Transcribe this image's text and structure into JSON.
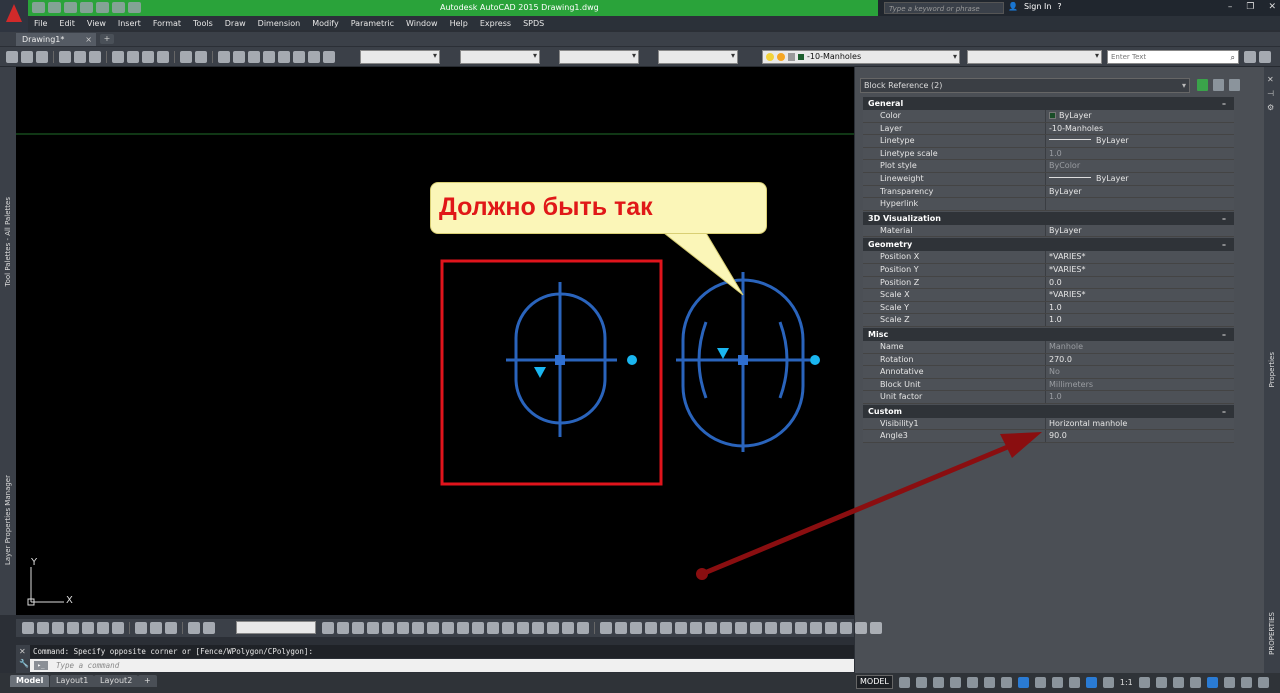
{
  "window": {
    "title": "Autodesk AutoCAD 2015    Drawing1.dwg",
    "search_placeholder": "Type a keyword or phrase",
    "sign_in": "Sign In",
    "help": "?",
    "minimize": "–",
    "restore": "❐",
    "close": "✕"
  },
  "menu": [
    "File",
    "Edit",
    "View",
    "Insert",
    "Format",
    "Tools",
    "Draw",
    "Dimension",
    "Modify",
    "Parametric",
    "Window",
    "Help",
    "Express",
    "SPDS"
  ],
  "tabs": {
    "document": "Drawing1*",
    "close": "×",
    "new_tab": "+"
  },
  "toolbar": {
    "layer_name": "-10-Manholes",
    "enter_text_placeholder": "Enter Text"
  },
  "palettes": {
    "tool_palettes": "Tool Palettes - All Palettes",
    "layer_manager": "Layer Properties Manager",
    "properties": "Properties",
    "properties_tab": "PROPERTIES"
  },
  "canvas": {
    "callout": "Должно быть так",
    "ucs_x": "X",
    "ucs_y": "Y"
  },
  "properties": {
    "selection": "Block Reference (2)",
    "sections": {
      "general": {
        "title": "General",
        "rows": [
          {
            "key": "Color",
            "value": "ByLayer"
          },
          {
            "key": "Layer",
            "value": "-10-Manholes"
          },
          {
            "key": "Linetype",
            "value": "ByLayer"
          },
          {
            "key": "Linetype scale",
            "value": "1.0"
          },
          {
            "key": "Plot style",
            "value": "ByColor"
          },
          {
            "key": "Lineweight",
            "value": "ByLayer"
          },
          {
            "key": "Transparency",
            "value": "ByLayer"
          },
          {
            "key": "Hyperlink",
            "value": ""
          }
        ]
      },
      "visualization": {
        "title": "3D Visualization",
        "rows": [
          {
            "key": "Material",
            "value": "ByLayer"
          }
        ]
      },
      "geometry": {
        "title": "Geometry",
        "rows": [
          {
            "key": "Position X",
            "value": "*VARIES*"
          },
          {
            "key": "Position Y",
            "value": "*VARIES*"
          },
          {
            "key": "Position Z",
            "value": "0.0"
          },
          {
            "key": "Scale X",
            "value": "*VARIES*"
          },
          {
            "key": "Scale Y",
            "value": "1.0"
          },
          {
            "key": "Scale Z",
            "value": "1.0"
          }
        ]
      },
      "misc": {
        "title": "Misc",
        "rows": [
          {
            "key": "Name",
            "value": "Manhole"
          },
          {
            "key": "Rotation",
            "value": "270.0"
          },
          {
            "key": "Annotative",
            "value": "No"
          },
          {
            "key": "Block Unit",
            "value": "Millimeters"
          },
          {
            "key": "Unit factor",
            "value": "1.0"
          }
        ]
      },
      "custom": {
        "title": "Custom",
        "rows": [
          {
            "key": "Visibility1",
            "value": "Horizontal manhole"
          },
          {
            "key": "Angle3",
            "value": "90.0"
          }
        ]
      },
      "collapse": "–"
    }
  },
  "command": {
    "history": "Command: Specify opposite corner or [Fence/WPolygon/CPolygon]:",
    "placeholder": "Type a command"
  },
  "status": {
    "layouts": [
      "Model",
      "Layout1",
      "Layout2"
    ],
    "add_layout": "+",
    "model_button": "MODEL",
    "scale": "1:1"
  },
  "colors": {
    "title_green": "#2aa33a",
    "callout_text": "#e01818",
    "callout_bg": "#fbf6b8",
    "manhole_blue": "#2f6fd1",
    "marker_cyan": "#1ab6f0",
    "selection_red": "#e0141c",
    "arrow_darkred": "#8a0e10"
  }
}
